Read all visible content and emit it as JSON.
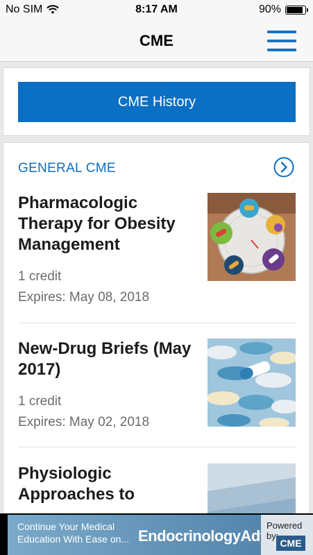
{
  "status_bar": {
    "carrier": "No SIM",
    "time": "8:17 AM",
    "battery": "90%",
    "battery_level": 0.9
  },
  "nav": {
    "title": "CME",
    "menu_icon": "hamburger-menu-icon"
  },
  "history_button": {
    "label": "CME History"
  },
  "section": {
    "title": "GENERAL CME",
    "icon": "chevron-right-circle-icon"
  },
  "articles": [
    {
      "title": "Pharmacologic Therapy for Obesity Management",
      "credits": "1 credit",
      "expires": "Expires: May 08, 2018"
    },
    {
      "title": "New-Drug Briefs (May 2017)",
      "credits": "1 credit",
      "expires": "Expires: May 02, 2018"
    },
    {
      "title": "Physiologic Approaches to",
      "credits": "",
      "expires": ""
    }
  ],
  "banner": {
    "text": "Continue Your Medical Education With Ease on...",
    "brand": "EndocrinologyAdvisor",
    "powered_by": "Powered by:",
    "logo": "CME"
  },
  "colors": {
    "accent": "#0b6fc3",
    "title_text": "#1b1b1b",
    "meta_text": "#6b6b6b"
  }
}
